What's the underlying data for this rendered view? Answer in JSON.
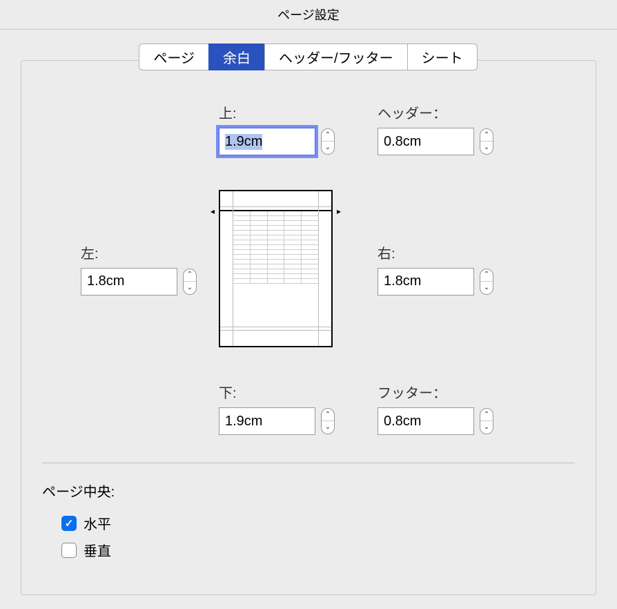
{
  "title": "ページ設定",
  "tabs": {
    "page": "ページ",
    "margin": "余白",
    "headerfooter": "ヘッダー/フッター",
    "sheet": "シート"
  },
  "margins": {
    "top_label": "上:",
    "top_value": "1.9cm",
    "header_label": "ヘッダー：",
    "header_value": "0.8cm",
    "left_label": "左:",
    "left_value": "1.8cm",
    "right_label": "右:",
    "right_value": "1.8cm",
    "bottom_label": "下:",
    "bottom_value": "1.9cm",
    "footer_label": "フッター：",
    "footer_value": "0.8cm"
  },
  "center": {
    "section_label": "ページ中央:",
    "horizontal_label": "水平",
    "horizontal_checked": true,
    "vertical_label": "垂直",
    "vertical_checked": false
  }
}
